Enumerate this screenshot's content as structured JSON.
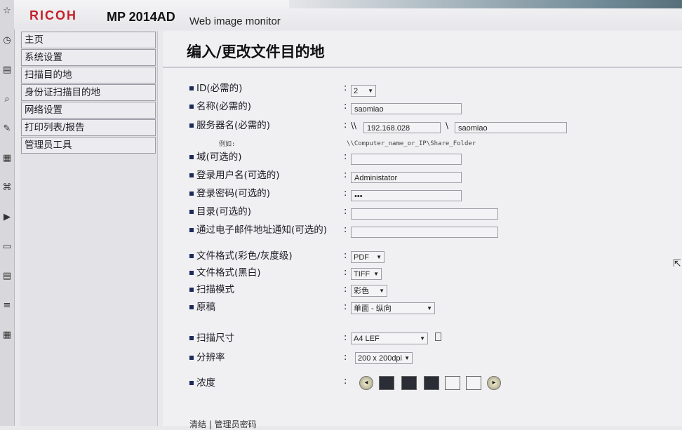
{
  "header": {
    "logo": "RICOH",
    "model": "MP 2014AD",
    "subtitle": "Web image monitor"
  },
  "sidebar": {
    "items": [
      {
        "label": "主页"
      },
      {
        "label": "系统设置"
      },
      {
        "label": "扫描目的地"
      },
      {
        "label": "身份证扫描目的地"
      },
      {
        "label": "网络设置"
      },
      {
        "label": "打印列表/报告"
      },
      {
        "label": "管理员工具"
      }
    ]
  },
  "page": {
    "title": "编入/更改文件目的地"
  },
  "form": {
    "id_label": "ID(必需的)",
    "id_value": "2",
    "name_label": "名称(必需的)",
    "name_value": "saomiao",
    "server_label": "服务器名(必需的)",
    "server_prefix": "\\\\",
    "server_value": "192.168.028",
    "server_sep": "\\",
    "share_value": "saomiao",
    "example_label": "例如:",
    "example_text": "\\\\Computer_name_or_IP\\Share_Folder",
    "domain_label": "域(可选的)",
    "domain_value": "",
    "user_label": "登录用户名(可选的)",
    "user_value": "Administator",
    "password_label": "登录密码(可选的)",
    "password_value": "•••",
    "directory_label": "目录(可选的)",
    "directory_value": "",
    "notify_label": "通过电子邮件地址通知(可选的)",
    "notify_value": "",
    "format_color_label": "文件格式(彩色/灰度级)",
    "format_color_value": "PDF",
    "format_bw_label": "文件格式(黑白)",
    "format_bw_value": "TIFF",
    "scan_mode_label": "扫描模式",
    "scan_mode_value": "彩色",
    "original_label": "原稿",
    "original_value": "单面 - 纵向",
    "scan_size_label": "扫描尺寸",
    "scan_size_value": "A4 LEF",
    "resolution_label": "分辨率",
    "resolution_value": "200 x 200dpi",
    "density_label": "浓度",
    "footer_link": "清结 | 管理员密码"
  },
  "colors": {
    "logo_red": "#c4202a",
    "bullet_navy": "#1e2a5a"
  }
}
